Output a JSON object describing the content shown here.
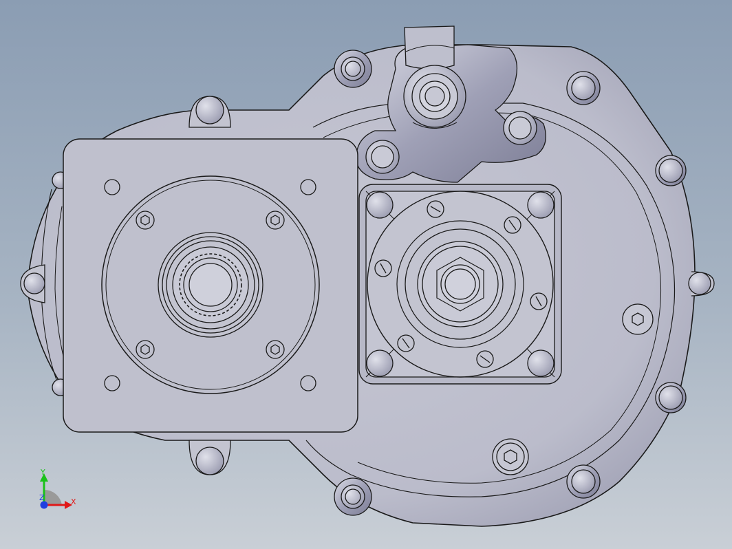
{
  "viewport": {
    "background_top": "#8b9db3",
    "background_bottom": "#c9cfd6",
    "part_fill": "#c3c4d0",
    "part_fill_dark": "#a9aabb",
    "edge_color": "#1a1a1a"
  },
  "triad": {
    "x_label": "X",
    "y_label": "Y",
    "z_label": "Z",
    "x_color": "#e01818",
    "y_color": "#19c219",
    "z_color": "#1f3fe0"
  }
}
